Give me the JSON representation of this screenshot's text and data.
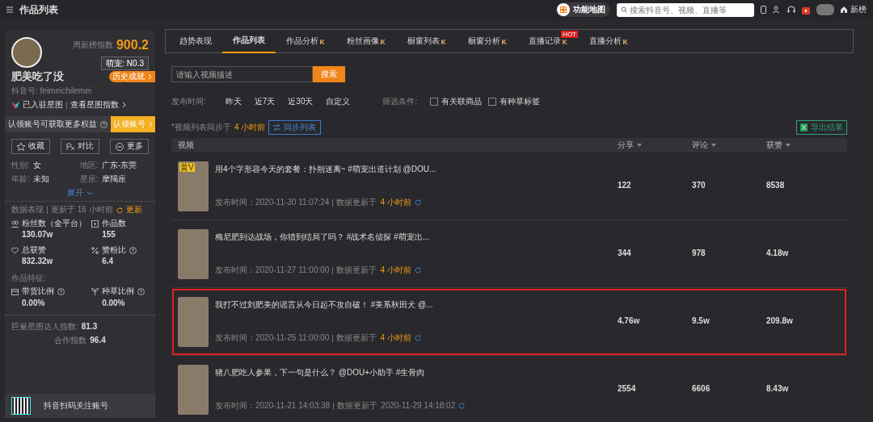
{
  "topbar": {
    "title": "作品列表",
    "map_button": "功能地图",
    "search": {
      "placeholder": "搜索抖音号、视频、直播等"
    },
    "home_label": "新榜"
  },
  "profile": {
    "index_label": "周新榜指数",
    "index_value": "900.2",
    "rank": "萌宠: N0.3",
    "name": "肥美吃了没",
    "history_button": "历史成就",
    "account_id": "抖音号: feimeichilemei",
    "star_joined": "已入驻星图",
    "star_link": "查看星图指数",
    "claim_text": "认领账号可获取更多权益",
    "claim_button": "认领账号",
    "actions": [
      "收藏",
      "对比",
      "更多"
    ],
    "info": [
      {
        "label": "性别:",
        "value": "女"
      },
      {
        "label": "地区:",
        "value": "广东-东莞"
      },
      {
        "label": "年龄:",
        "value": "未知"
      },
      {
        "label": "星座:",
        "value": "摩羯座"
      }
    ],
    "expand": "展开",
    "data_title": "数据表现",
    "data_updated": "更新于 16 小时前",
    "refresh": "更新",
    "stats": [
      {
        "label": "粉丝数（全平台）",
        "value": "130.07w"
      },
      {
        "label": "作品数",
        "value": "155"
      },
      {
        "label": "总获赞",
        "value": "832.32w"
      },
      {
        "label": "赞粉比",
        "value": "6.4",
        "help": true
      }
    ],
    "features_title": "作品特征:",
    "features": [
      {
        "label": "带货比例",
        "value": "0.00%",
        "help": true
      },
      {
        "label": "种草比例",
        "value": "0.00%",
        "help": true
      }
    ],
    "star_index_label": "巨量星图达人指数:",
    "star_index_value": "81.3",
    "coop_label": "合作指数",
    "coop_value": "96.4",
    "qr_text": "抖音扫码关注账号"
  },
  "tabs": [
    {
      "label": "趋势表现",
      "selected": false,
      "vip": false,
      "hot": false
    },
    {
      "label": "作品列表",
      "selected": true,
      "vip": false,
      "hot": false
    },
    {
      "label": "作品分析",
      "selected": false,
      "vip": true,
      "hot": false
    },
    {
      "label": "粉丝画像",
      "selected": false,
      "vip": true,
      "hot": false
    },
    {
      "label": "橱窗列表",
      "selected": false,
      "vip": true,
      "hot": false
    },
    {
      "label": "橱窗分析",
      "selected": false,
      "vip": true,
      "hot": false
    },
    {
      "label": "直播记录",
      "selected": false,
      "vip": true,
      "hot": true,
      "hot_label": "HOT"
    },
    {
      "label": "直播分析",
      "selected": false,
      "vip": true,
      "hot": false
    }
  ],
  "search": {
    "placeholder": "请输入视频描述",
    "button": "搜索"
  },
  "time_filter": {
    "label": "发布时间:",
    "options": [
      "昨天",
      "近7天",
      "近30天",
      "自定义"
    ]
  },
  "conditions": {
    "label": "筛选条件:",
    "items": [
      {
        "label": "有关联商品",
        "checked": false
      },
      {
        "label": "有种草标签",
        "checked": false
      }
    ]
  },
  "sync": {
    "text": "*视频列表同步于",
    "time": "4 小时前",
    "button": "同步列表"
  },
  "export_button": "导出结果",
  "table": {
    "columns": [
      {
        "label": "视频",
        "sortable": false
      },
      {
        "label": "分享",
        "sortable": true
      },
      {
        "label": "评论",
        "sortable": true
      },
      {
        "label": "获赞",
        "sortable": true
      }
    ],
    "rows": [
      {
        "title": "用4个字形容今天的套餐：扑朔迷离~ #萌宠出道计划 @DOU...",
        "badge": "黄V",
        "published": "发布时间：2020-11-30 11:07:24",
        "updated_label": "数据更新于",
        "updated": "4 小时前",
        "recent": true,
        "share": "122",
        "comments": "370",
        "likes": "8538",
        "highlighted": false
      },
      {
        "title": "梅尼肥到达战场，你猜到结局了吗？ #战术名侦探 #萌宠出...",
        "published": "发布时间：2020-11-27 11:00:00",
        "updated_label": "数据更新于",
        "updated": "4 小时前",
        "recent": true,
        "share": "344",
        "comments": "978",
        "likes": "4.18w",
        "highlighted": false
      },
      {
        "title": "我打不过刘肥美的谣言从今日起不攻自破！ #美系秋田犬 @...",
        "published": "发布时间：2020-11-25 11:00:00",
        "updated_label": "数据更新于",
        "updated": "4 小时前",
        "recent": true,
        "share": "4.76w",
        "comments": "9.5w",
        "likes": "209.8w",
        "highlighted": true
      },
      {
        "title": "猪八肥吃人参果，下一句是什么？ @DOU+小助手 #生骨肉",
        "published": "发布时间：2020-11-21 14:03:38",
        "updated_label": "数据更新于",
        "updated": "2020-11-29 14:18:02",
        "recent": false,
        "share": "2554",
        "comments": "6606",
        "likes": "8.43w",
        "highlighted": false
      }
    ]
  }
}
